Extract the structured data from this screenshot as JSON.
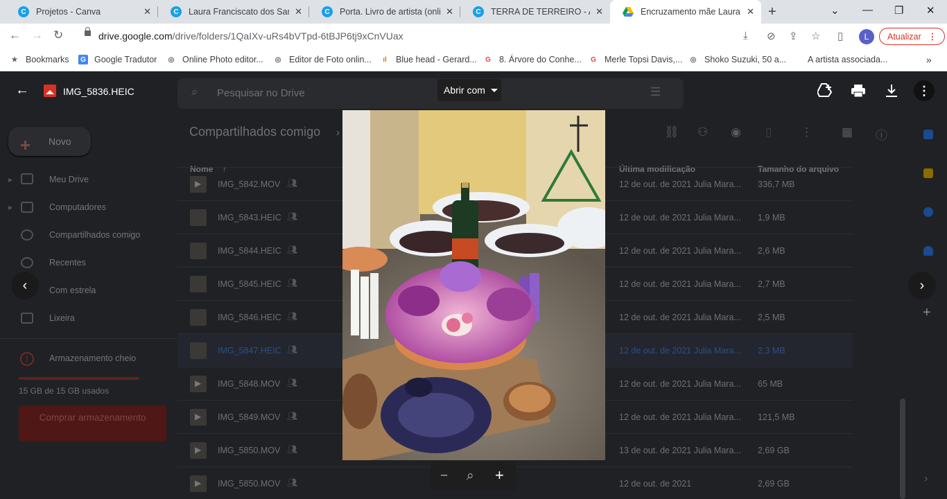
{
  "browser": {
    "tabs": [
      {
        "label": "Projetos - Canva",
        "icon": "canva-icon"
      },
      {
        "label": "Laura Franciscato dos Santos",
        "icon": "canva-icon"
      },
      {
        "label": "Porta. Livro de artista (online)",
        "icon": "canva-icon"
      },
      {
        "label": "TERRA DE TERREIRO - Apresentação",
        "icon": "canva-icon"
      },
      {
        "label": "Encruzamento mãe Laura 💜",
        "icon": "google-drive-icon",
        "active": true
      }
    ],
    "url_domain": "drive.google.com",
    "url_path": "/drive/folders/1QaIXv-uRs4bVTpd-6tBJP6tj9xCnVUax",
    "profile_initial": "L",
    "update_label": "Atualizar",
    "bookmarks": [
      {
        "label": "Bookmarks",
        "icon": "star-icon"
      },
      {
        "label": "Google Tradutor",
        "icon": "google-translate-icon"
      },
      {
        "label": "Online Photo editor...",
        "icon": "globe-icon"
      },
      {
        "label": "Editor de Foto onlin...",
        "icon": "globe-icon"
      },
      {
        "label": "Blue head - Gerard...",
        "icon": "bar-icon"
      },
      {
        "label": "8. Árvore do Conhe...",
        "icon": "google-icon"
      },
      {
        "label": "Merle Topsi Davis,...",
        "icon": "google-icon"
      },
      {
        "label": "Shoko Suzuki, 50 a...",
        "icon": "globe-icon"
      },
      {
        "label": "A artista associada...",
        "icon": ""
      }
    ]
  },
  "drive": {
    "search_placeholder": "Pesquisar no Drive",
    "new_label": "Novo",
    "sidebar": [
      {
        "label": "Meu Drive"
      },
      {
        "label": "Computadores"
      },
      {
        "label": "Compartilhados comigo"
      },
      {
        "label": "Recentes"
      },
      {
        "label": "Com estrela"
      },
      {
        "label": "Lixeira"
      }
    ],
    "storage_label": "Armazenamento cheio",
    "storage_used": "15 GB de 15 GB usados",
    "storage_fraction": 1.0,
    "buy_label": "Comprar armazenamento",
    "location_title": "Compartilhados comigo",
    "columns": {
      "name": "Nome",
      "modified": "Última modificação",
      "size": "Tamanho do arquivo"
    },
    "rows": [
      {
        "name": "IMG_5842.MOV",
        "modified": "12 de out. de 2021 Julia Mara...",
        "size": "336,7 MB",
        "type": "video"
      },
      {
        "name": "IMG_5843.HEIC",
        "modified": "12 de out. de 2021 Julia Mara...",
        "size": "1,9 MB",
        "type": "image"
      },
      {
        "name": "IMG_5844.HEIC",
        "modified": "12 de out. de 2021 Julia Mara...",
        "size": "2,6 MB",
        "type": "image"
      },
      {
        "name": "IMG_5845.HEIC",
        "modified": "12 de out. de 2021 Julia Mara...",
        "size": "2,7 MB",
        "type": "image"
      },
      {
        "name": "IMG_5846.HEIC",
        "modified": "12 de out. de 2021 Julia Mara...",
        "size": "2,5 MB",
        "type": "image"
      },
      {
        "name": "IMG_5847.HEIC",
        "modified": "12 de out. de 2021 Julia Mara...",
        "size": "2,3 MB",
        "type": "image",
        "selected": true
      },
      {
        "name": "IMG_5848.MOV",
        "modified": "12 de out. de 2021 Julia Mara...",
        "size": "65 MB",
        "type": "video"
      },
      {
        "name": "IMG_5849.MOV",
        "modified": "12 de out. de 2021 Julia Mara...",
        "size": "121,5 MB",
        "type": "video"
      },
      {
        "name": "IMG_5850.MOV",
        "modified": "13 de out. de 2021 Julia Mara...",
        "size": "2,69 GB",
        "type": "video"
      },
      {
        "name": "IMG_5850.MOV",
        "modified": "12 de out. de 2021",
        "size": "2,69 GB",
        "type": "video"
      }
    ]
  },
  "viewer": {
    "file_name": "IMG_5836.HEIC",
    "open_with_label": "Abrir com",
    "actions": [
      "add-to-drive-icon",
      "print-icon",
      "download-icon",
      "more-vert-icon"
    ],
    "photo_alt": "Altar com garrafa de vinho, tigelas, flores lilases e rosas, velas e colares de contas"
  },
  "colors": {
    "drive_bg": "#202124",
    "accent_red": "#d93025",
    "selected_text": "#2b4f86",
    "chrome_tab_bg": "#dee1e6"
  }
}
